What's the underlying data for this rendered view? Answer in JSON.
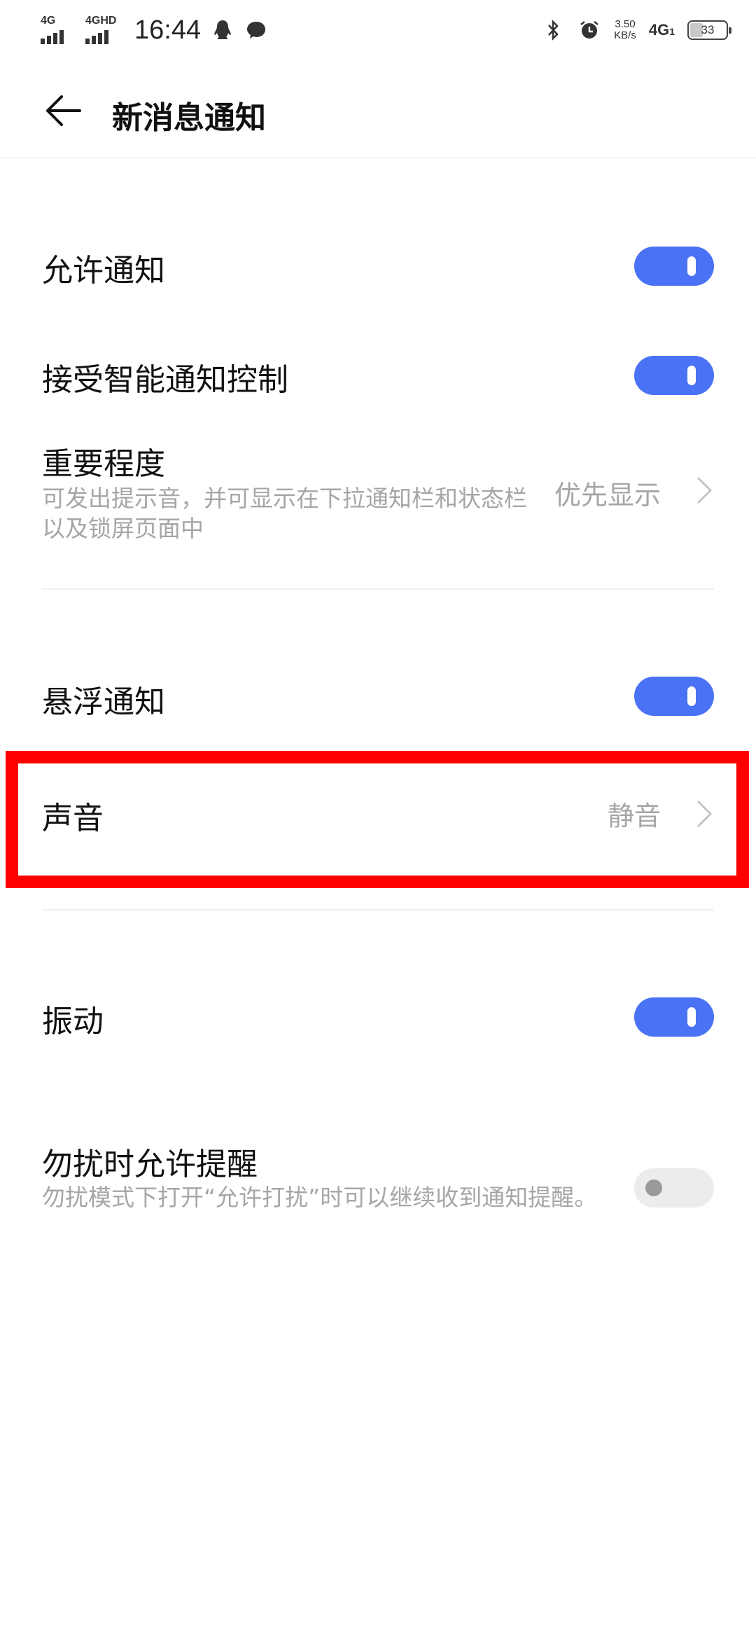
{
  "status_bar": {
    "sim1_label": "4G",
    "sim2_label": "4GHD",
    "time": "16:44",
    "speed_value": "3.50",
    "speed_unit": "KB/s",
    "network": "4G",
    "network_sub": "1",
    "battery": "33",
    "battery_level": 0.33
  },
  "header": {
    "title": "新消息通知"
  },
  "settings": {
    "allow_notifications": {
      "label": "允许通知",
      "on": true
    },
    "smart_control": {
      "label": "接受智能通知控制",
      "on": true
    },
    "importance": {
      "label": "重要程度",
      "description": "可发出提示音，并可显示在下拉通知栏和状态栏以及锁屏页面中",
      "value": "优先显示"
    },
    "floating": {
      "label": "悬浮通知",
      "on": true
    },
    "sound": {
      "label": "声音",
      "value": "静音"
    },
    "vibration": {
      "label": "振动",
      "on": true
    },
    "dnd_reminder": {
      "label": "勿扰时允许提醒",
      "description": "勿扰模式下打开“允许打扰”时可以继续收到通知提醒。",
      "on": false
    }
  },
  "colors": {
    "toggle_on": "#4a72f5",
    "toggle_off": "#ececec",
    "highlight": "#ff0000",
    "secondary_text": "#a6a6a6"
  }
}
